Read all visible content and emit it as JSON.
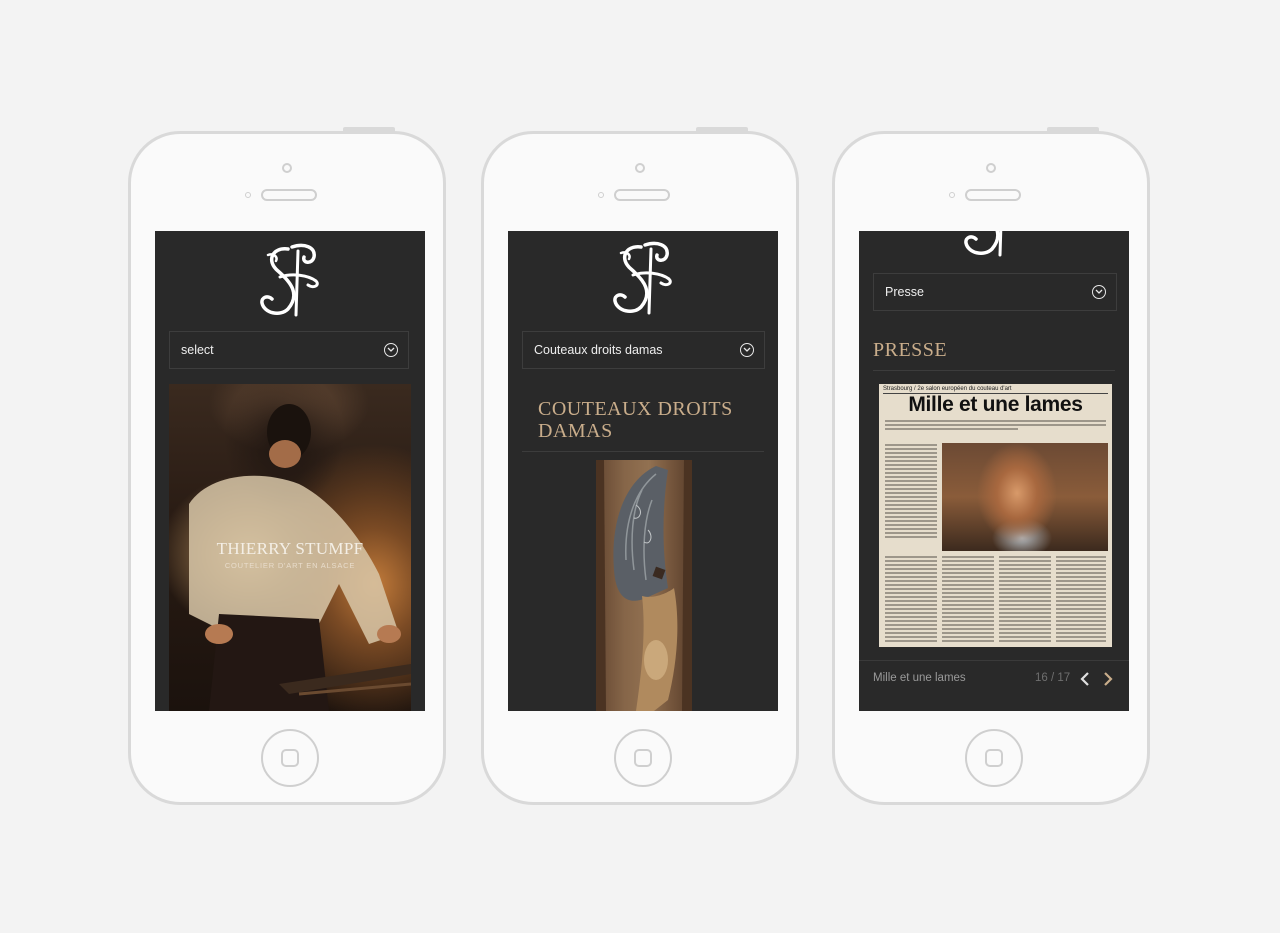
{
  "colors": {
    "background": "#f3f3f3",
    "screen": "#292929",
    "accent": "#c9ad8b"
  },
  "phone1": {
    "select_label": "select",
    "hero_name": "THIERRY STUMPF",
    "hero_subtitle": "COUTELIER D'ART EN ALSACE"
  },
  "phone2": {
    "select_label": "Couteaux droits damas",
    "title_line1": "COUTEAUX DROITS",
    "title_line2": "DAMAS"
  },
  "phone3": {
    "select_label": "Presse",
    "title": "PRESSE",
    "article_header": "Strasbourg / 2e salon européen du couteau d'art",
    "article_headline": "Mille et une lames",
    "caption": "Mille et une lames",
    "counter": "16 / 17"
  },
  "icons": {
    "logo": "ts-monogram-icon",
    "dropdown": "chevron-circle-down-icon",
    "prev": "chevron-left-icon",
    "next": "chevron-right-icon"
  }
}
